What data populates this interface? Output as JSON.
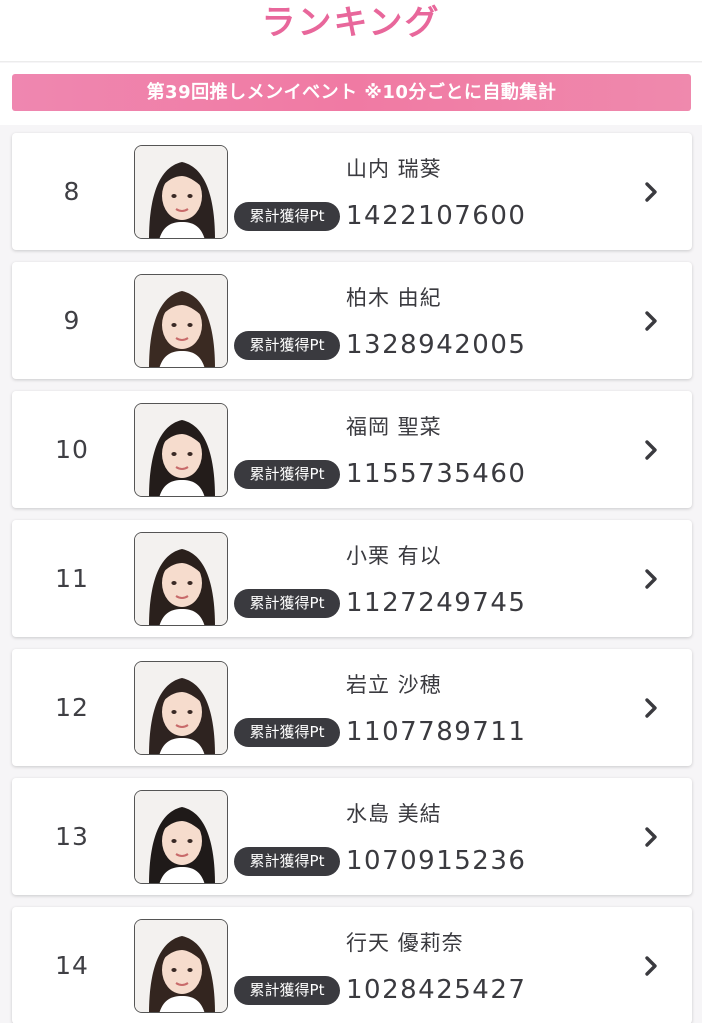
{
  "header": {
    "title": "ランキング"
  },
  "event_banner": {
    "text": "第39回推しメンイベント ※10分ごとに自動集計"
  },
  "ranking": {
    "badge_label": "累計獲得Pt",
    "entries": [
      {
        "rank": "8",
        "name": "山内 瑞葵",
        "points": "1422107600"
      },
      {
        "rank": "9",
        "name": "柏木 由紀",
        "points": "1328942005"
      },
      {
        "rank": "10",
        "name": "福岡 聖菜",
        "points": "1155735460"
      },
      {
        "rank": "11",
        "name": "小栗 有以",
        "points": "1127249745"
      },
      {
        "rank": "12",
        "name": "岩立 沙穂",
        "points": "1107789711"
      },
      {
        "rank": "13",
        "name": "水島 美結",
        "points": "1070915236"
      },
      {
        "rank": "14",
        "name": "行天 優莉奈",
        "points": "1028425427"
      }
    ]
  },
  "colors": {
    "accent_pink": "#e8679b",
    "badge_dark": "#3a3a3f",
    "card_bg": "#ffffff",
    "page_bg": "#f6f5f7"
  },
  "icons": {
    "row_action": "chevron-right-icon",
    "avatar": "member-photo"
  }
}
